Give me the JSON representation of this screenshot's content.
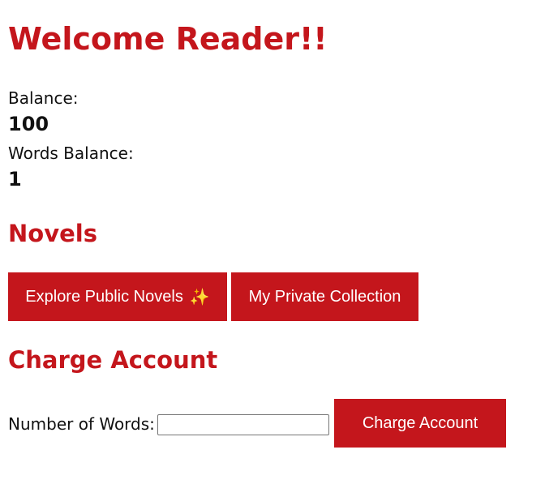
{
  "header": {
    "title": "Welcome Reader!!"
  },
  "account": {
    "balance_label": "Balance:",
    "balance_value": "100",
    "words_balance_label": "Words Balance:",
    "words_balance_value": "1"
  },
  "novels": {
    "title": "Novels",
    "explore_label": "Explore Public Novels",
    "explore_icon": "✨",
    "private_label": "My Private Collection"
  },
  "charge": {
    "title": "Charge Account",
    "words_label": "Number of Words:",
    "words_value": "",
    "button_label": "Charge Account"
  },
  "colors": {
    "accent": "#c4161c",
    "text": "#111111",
    "background": "#ffffff"
  }
}
